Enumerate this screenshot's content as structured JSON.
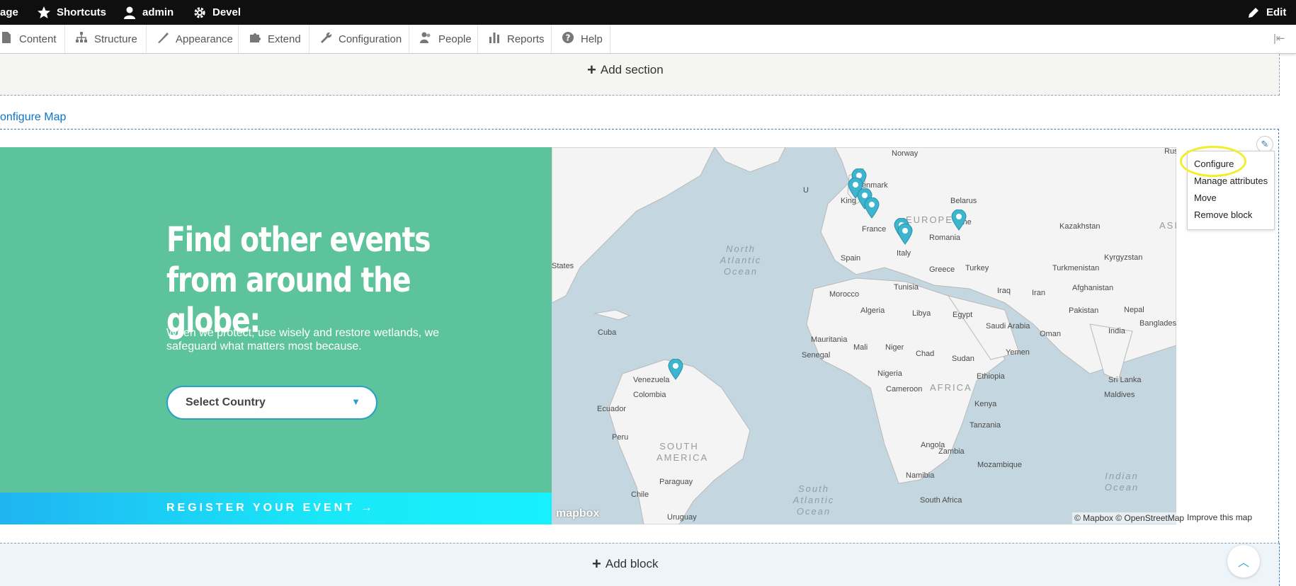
{
  "toolbar": {
    "manage_fragment": "age",
    "shortcuts": "Shortcuts",
    "user": "admin",
    "devel": "Devel",
    "edit": "Edit"
  },
  "tray": {
    "tabs": [
      "Content",
      "Structure",
      "Appearance",
      "Extend",
      "Configuration",
      "People",
      "Reports",
      "Help"
    ]
  },
  "layout": {
    "add_section": "Add section",
    "configure_map_link": "onfigure Map",
    "add_block": "Add block"
  },
  "hero": {
    "headline": "Find other events from around the globe:",
    "subtext": "When we protect, use wisely and restore wetlands, we safeguard what matters most because.",
    "select_label": "Select Country",
    "register": "REGISTER YOUR EVENT →"
  },
  "map": {
    "labels": {
      "norway": "Norway",
      "denmark": "Denmark",
      "belarus": "Belarus",
      "united_kingdom_fragment": "U",
      "kingdom_fragment": "King",
      "france": "France",
      "europe": "EUROPE",
      "ukraine_fragment": "aine",
      "romania": "Romania",
      "italy": "Italy",
      "kazakhstan": "Kazakhstan",
      "asia_fragment": "ASI",
      "rus_fragment": "Rus",
      "spain": "Spain",
      "greece": "Greece",
      "turkey": "Turkey",
      "turkmenistan": "Turkmenistan",
      "kyrgyzstan": "Kyrgyzstan",
      "states_fragment": "States",
      "morocco": "Morocco",
      "tunisia": "Tunisia",
      "iraq": "Iraq",
      "iran": "Iran",
      "afghanistan": "Afghanistan",
      "algeria": "Algeria",
      "libya": "Libya",
      "egypt": "Egypt",
      "pakistan": "Pakistan",
      "nepal": "Nepal",
      "cuba": "Cuba",
      "saudi_arabia": "Saudi Arabia",
      "oman": "Oman",
      "india": "India",
      "bangladesh": "Bangladesh",
      "mauritania": "Mauritania",
      "mali": "Mali",
      "niger": "Niger",
      "chad": "Chad",
      "sudan": "Sudan",
      "yemen": "Yemen",
      "senegal": "Senegal",
      "nigeria": "Nigeria",
      "ethiopia": "Ethiopia",
      "venezuela": "Venezuela",
      "cameroon": "Cameroon",
      "africa": "AFRICA",
      "sri_lanka": "Sri Lanka",
      "colombia": "Colombia",
      "maldives": "Maldives",
      "kenya": "Kenya",
      "ecuador": "Ecuador",
      "tanzania": "Tanzania",
      "peru": "Peru",
      "angola": "Angola",
      "zambia": "Zambia",
      "mozambique": "Mozambique",
      "namibia": "Namibia",
      "paraguay": "Paraguay",
      "chile": "Chile",
      "south_africa": "South Africa",
      "uruguay": "Uruguay"
    },
    "oceans": {
      "north_atlantic": "North Atlantic Ocean",
      "south_atlantic": "South Atlantic Ocean",
      "indian": "Indian Ocean"
    },
    "south_america": "SOUTH AMERICA",
    "logo": "mapbox",
    "attribution": "© Mapbox © OpenStreetMap",
    "improve": "Improve this map",
    "pin_color": "#3eb5cf"
  },
  "contextual_menu": {
    "items": [
      "Configure",
      "Manage attributes",
      "Move",
      "Remove block"
    ]
  },
  "colors": {
    "green": "#5dc39c",
    "toolbar": "#0f0f0f",
    "link": "#0c74c9",
    "highlight": "#f2ee2a"
  }
}
